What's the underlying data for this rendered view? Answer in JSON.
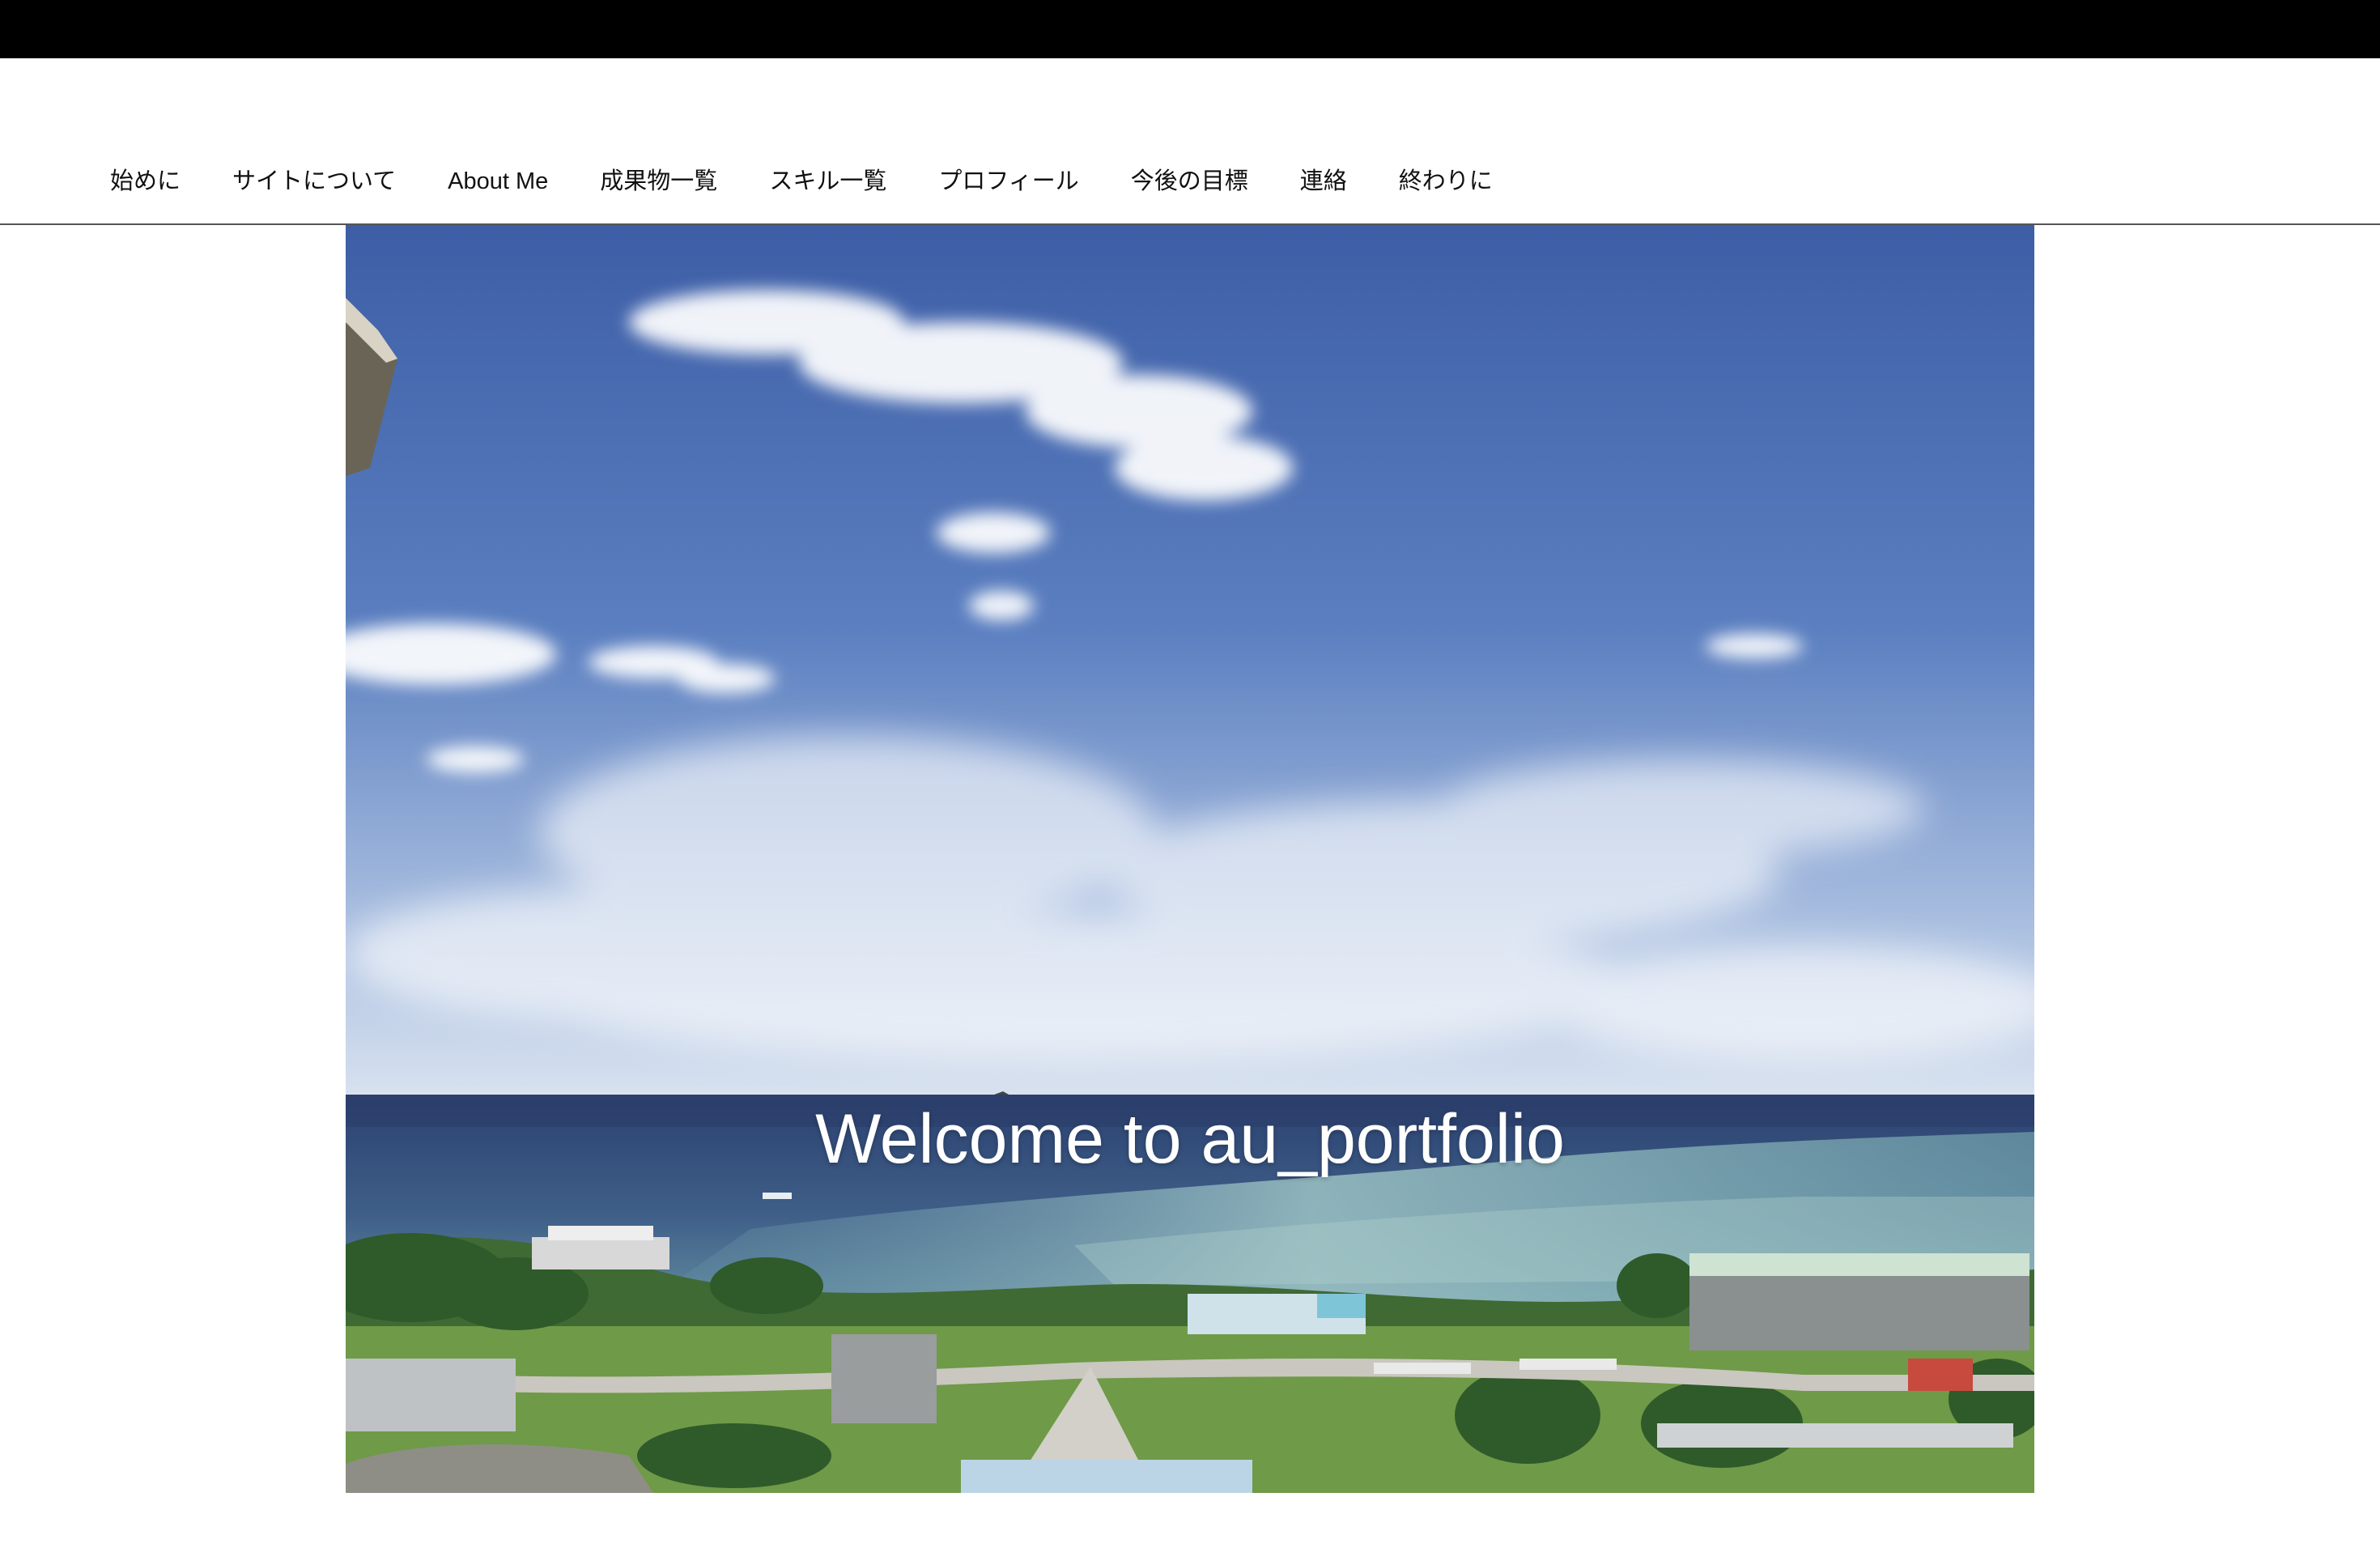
{
  "nav": {
    "items": [
      {
        "label": "始めに"
      },
      {
        "label": "サイトについて"
      },
      {
        "label": "About Me"
      },
      {
        "label": "成果物一覧"
      },
      {
        "label": "スキル一覧"
      },
      {
        "label": "プロフィール"
      },
      {
        "label": "今後の目標"
      },
      {
        "label": "連絡"
      },
      {
        "label": "終わりに"
      }
    ]
  },
  "hero": {
    "title": "Welcome to au_portfolio"
  },
  "colors": {
    "topbar": "#000000",
    "sky_top": "#3f5fa6",
    "sky_bottom": "#dde6f2",
    "sea_deep": "#2a3f6a",
    "sea_shallow": "#7fa8b3",
    "grass": "#5d8a3c"
  }
}
